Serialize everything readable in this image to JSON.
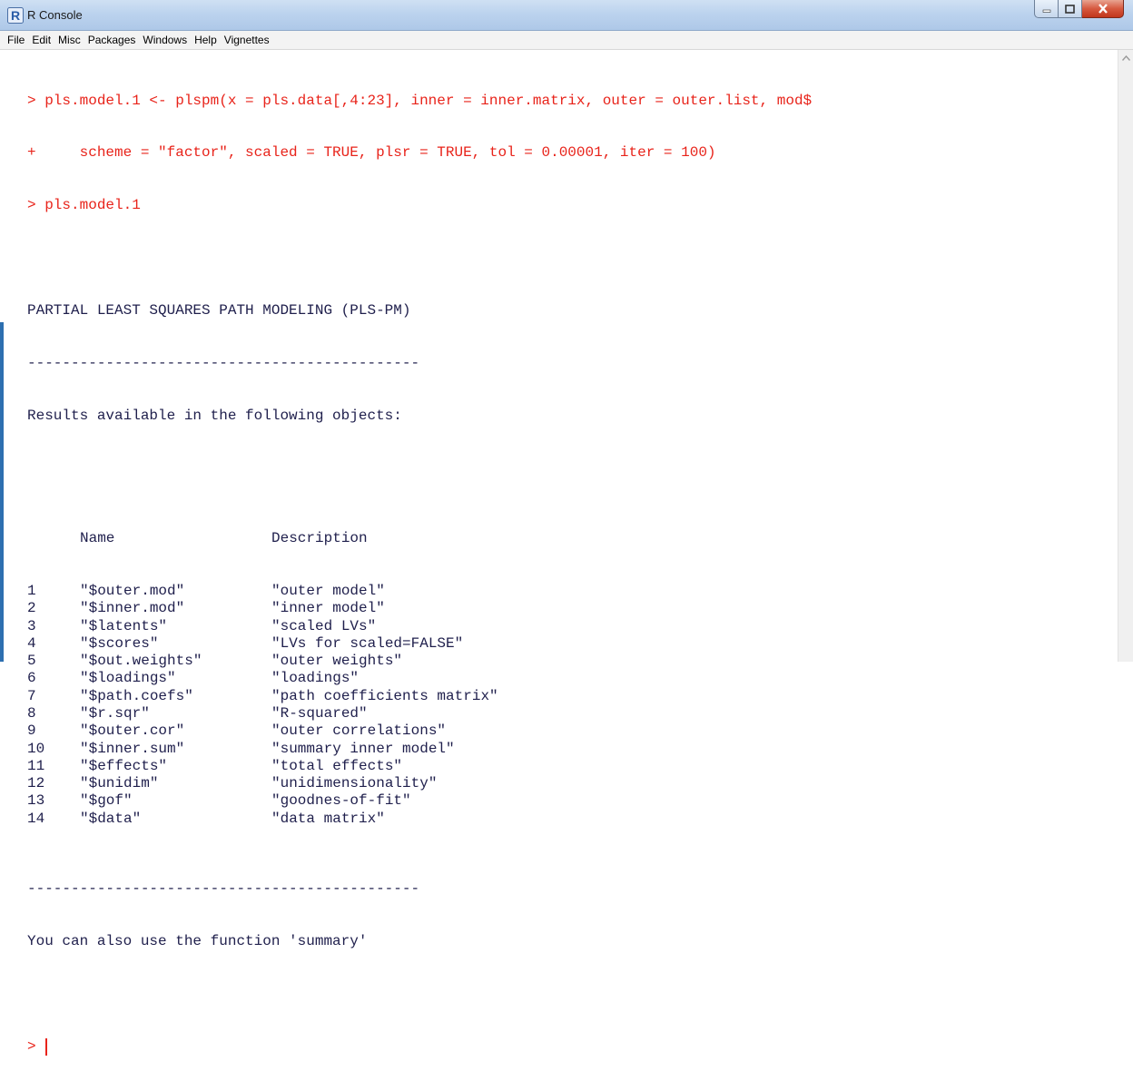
{
  "window": {
    "title": "R Console",
    "icon": "r-logo-icon"
  },
  "menu": [
    "File",
    "Edit",
    "Misc",
    "Packages",
    "Windows",
    "Help",
    "Vignettes"
  ],
  "console": {
    "commands": [
      "> pls.model.1 <- plspm(x = pls.data[,4:23], inner = inner.matrix, outer = outer.list, mod$",
      "+     scheme = \"factor\", scaled = TRUE, plsr = TRUE, tol = 0.00001, iter = 100)",
      "> pls.model.1"
    ],
    "heading": "PARTIAL LEAST SQUARES PATH MODELING (PLS-PM)",
    "divider": "---------------------------------------------",
    "intro": "Results available in the following objects:",
    "table_header": {
      "name": "Name",
      "description": "Description"
    },
    "rows": [
      {
        "idx": "1",
        "name": "\"$outer.mod\"",
        "desc": "\"outer model\""
      },
      {
        "idx": "2",
        "name": "\"$inner.mod\"",
        "desc": "\"inner model\""
      },
      {
        "idx": "3",
        "name": "\"$latents\"",
        "desc": "\"scaled LVs\""
      },
      {
        "idx": "4",
        "name": "\"$scores\"",
        "desc": "\"LVs for scaled=FALSE\""
      },
      {
        "idx": "5",
        "name": "\"$out.weights\"",
        "desc": "\"outer weights\""
      },
      {
        "idx": "6",
        "name": "\"$loadings\"",
        "desc": "\"loadings\""
      },
      {
        "idx": "7",
        "name": "\"$path.coefs\"",
        "desc": "\"path coefficients matrix\""
      },
      {
        "idx": "8",
        "name": "\"$r.sqr\"",
        "desc": "\"R-squared\""
      },
      {
        "idx": "9",
        "name": "\"$outer.cor\"",
        "desc": "\"outer correlations\""
      },
      {
        "idx": "10",
        "name": "\"$inner.sum\"",
        "desc": "\"summary inner model\""
      },
      {
        "idx": "11",
        "name": "\"$effects\"",
        "desc": "\"total effects\""
      },
      {
        "idx": "12",
        "name": "\"$unidim\"",
        "desc": "\"unidimensionality\""
      },
      {
        "idx": "13",
        "name": "\"$gof\"",
        "desc": "\"goodnes-of-fit\""
      },
      {
        "idx": "14",
        "name": "\"$data\"",
        "desc": "\"data matrix\""
      }
    ],
    "footer": "You can also use the function 'summary'",
    "prompt": ">"
  },
  "colors": {
    "command": "#e8231a",
    "output": "#1f1f4c",
    "titlebar": "#bcd3ee"
  }
}
